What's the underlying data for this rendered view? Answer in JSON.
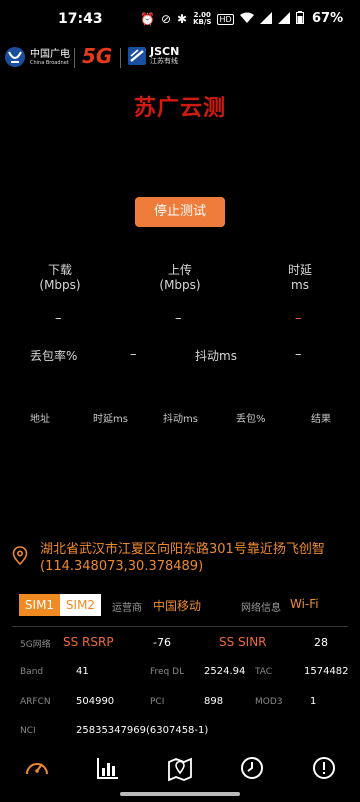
{
  "status_bar": {
    "time": "17:43",
    "net_speed_value": "2.00",
    "net_speed_unit": "KB/S",
    "battery": "67%"
  },
  "header": {
    "cbn_name_cn": "中国广电",
    "cbn_name_en": "China Broadnet",
    "fiveg": "5G",
    "jscn_name": "JSCN",
    "jscn_name_cn": "江苏有线"
  },
  "title": "苏广云测",
  "stop_button": "停止测试",
  "metrics": {
    "download_label": "下载",
    "download_unit": "(Mbps)",
    "upload_label": "上传",
    "upload_unit": "(Mbps)",
    "latency_label": "时延",
    "latency_unit": "ms",
    "download_value": "–",
    "upload_value": "–",
    "latency_value": "–",
    "loss_label": "丢包率%",
    "loss_value": "–",
    "jitter_label": "抖动ms",
    "jitter_value": "–"
  },
  "result_table": {
    "headers": [
      "地址",
      "时延ms",
      "抖动ms",
      "丢包%",
      "结果"
    ]
  },
  "location": {
    "address": "湖北省武汉市江夏区向阳东路301号靠近扬飞创智",
    "coords": "(114.348073,30.378489)"
  },
  "sim": {
    "tab1": "SIM1",
    "tab2": "SIM2",
    "operator_label": "运营商",
    "operator_value": "中国移动",
    "network_label": "网络信息",
    "network_value": "Wi-Fi"
  },
  "cell_info": {
    "net_label": "5G网络",
    "rsrp_label": "SS RSRP",
    "rsrp_value": "-76",
    "sinr_label": "SS SINR",
    "sinr_value": "28",
    "band_label": "Band",
    "band_value": "41",
    "freq_label": "Freq DL",
    "freq_value": "2524.94",
    "tac_label": "TAC",
    "tac_value": "1574482",
    "arfcn_label": "ARFCN",
    "arfcn_value": "504990",
    "pci_label": "PCI",
    "pci_value": "898",
    "mod3_label": "MOD3",
    "mod3_value": "1",
    "nci_label": "NCI",
    "nci_value": "25835347969(6307458-1)"
  },
  "colors": {
    "accent": "#ef8a2b",
    "title_red": "#d11a10",
    "button": "#ef7c3a"
  }
}
